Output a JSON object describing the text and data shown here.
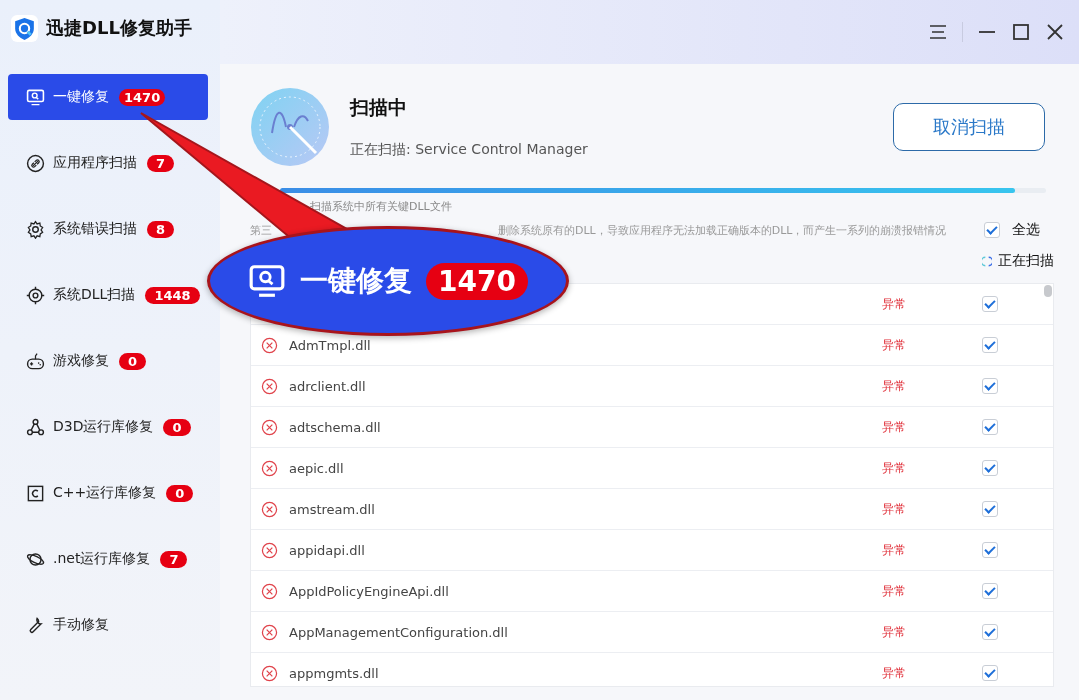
{
  "window": {
    "title": "迅捷DLL修复助手"
  },
  "sidebar": {
    "items": [
      {
        "kind": "monitor",
        "label": "一键修复",
        "badge": "1470",
        "selected": true
      },
      {
        "kind": "link",
        "label": "应用程序扫描",
        "badge": "7",
        "selected": false
      },
      {
        "kind": "gear",
        "label": "系统错误扫描",
        "badge": "8",
        "selected": false
      },
      {
        "kind": "target",
        "label": "系统DLL扫描",
        "badge": "1448",
        "selected": false
      },
      {
        "kind": "gamepad",
        "label": "游戏修复",
        "badge": "0",
        "selected": false
      },
      {
        "kind": "nodes",
        "label": "D3D运行库修复",
        "badge": "0",
        "selected": false
      },
      {
        "kind": "cbox",
        "label": "C++运行库修复",
        "badge": "0",
        "selected": false
      },
      {
        "kind": "planet",
        "label": ".net运行库修复",
        "badge": "7",
        "selected": false
      },
      {
        "kind": "wrench",
        "label": "手动修复",
        "selected": false
      }
    ]
  },
  "scan": {
    "title": "扫描中",
    "current": "正在扫描: Service Control Manager",
    "cancel_button": "取消扫描",
    "level": 0.96,
    "hint": "扫描系统中所有关键DLL文件",
    "warning_start": "第三",
    "warning_end": "删除系统原有的DLL，导致应用程序无法加载正确版本的DLL，而产生一系列的崩溃报错情况",
    "select_all": {
      "label": "全选",
      "checked": true
    },
    "status": "正在扫描"
  },
  "files": [
    {
      "status": "异常",
      "checked": true
    },
    {
      "name": "AdmTmpl.dll",
      "status": "异常",
      "checked": true
    },
    {
      "name": "adrclient.dll",
      "status": "异常",
      "checked": true
    },
    {
      "name": "adtschema.dll",
      "status": "异常",
      "checked": true
    },
    {
      "name": "aepic.dll",
      "status": "异常",
      "checked": true
    },
    {
      "name": "amstream.dll",
      "status": "异常",
      "checked": true
    },
    {
      "name": "appidapi.dll",
      "status": "异常",
      "checked": true
    },
    {
      "name": "AppIdPolicyEngineApi.dll",
      "status": "异常",
      "checked": true
    },
    {
      "name": "AppManagementConfiguration.dll",
      "status": "异常",
      "checked": true
    },
    {
      "name": "appmgmts.dll",
      "status": "异常",
      "checked": true
    }
  ],
  "callout": {
    "label": "一键修复",
    "badge": "1470"
  }
}
